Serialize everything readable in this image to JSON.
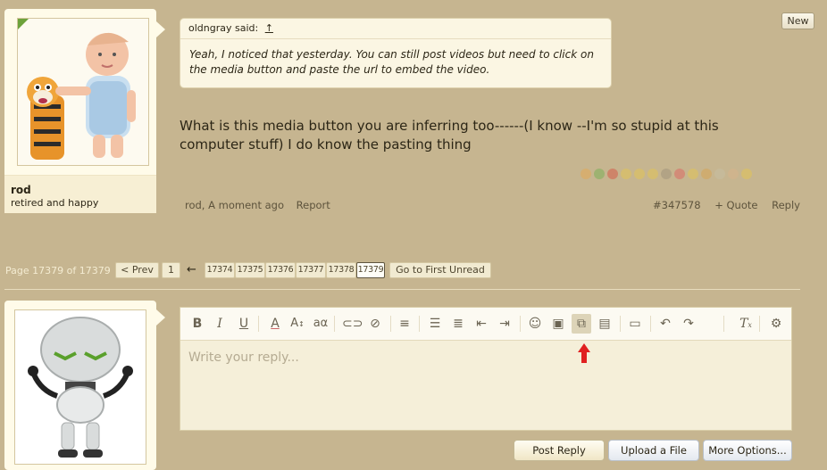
{
  "post": {
    "user_name": "rod",
    "user_title": "retired and happy",
    "quote_author": "oldngray said:",
    "quote_arrow": "↑",
    "quote_text": "Yeah, I noticed that yesterday. You can still post videos but need to click on the media button and paste the url to embed the video.",
    "message": "What is this media button you are inferring too------(I know --I'm so stupid at this computer stuff) I do know the pasting thing",
    "meta_author_time": "rod, A moment ago",
    "report_label": "Report",
    "post_number": "#347578",
    "quote_label": "+ Quote",
    "reply_label": "Reply",
    "new_badge": "New"
  },
  "pagination": {
    "label": "Page 17379 of 17379",
    "prev_label": "< Prev",
    "first_page": "1",
    "back_arrow": "←",
    "pages": [
      "17374",
      "17375",
      "17376",
      "17377",
      "17378",
      "17379"
    ],
    "current_page": "17379",
    "first_unread_label": "Go to First Unread"
  },
  "editor": {
    "placeholder": "Write your reply...",
    "tools": [
      "bold",
      "italic",
      "underline",
      "text-color",
      "font-size",
      "font-family",
      "link",
      "unlink",
      "align",
      "bulleted-list",
      "numbered-list",
      "outdent",
      "indent",
      "smilies",
      "image",
      "media",
      "code",
      "drafts",
      "undo",
      "redo",
      "remove-format",
      "toggle-bbcode"
    ]
  },
  "buttons": {
    "post_reply": "Post Reply",
    "upload_file": "Upload a File",
    "more_options": "More Options..."
  },
  "colors": {
    "background": "#c6b590",
    "panel": "#fffbe9",
    "highlight_arrow": "#e02020"
  }
}
